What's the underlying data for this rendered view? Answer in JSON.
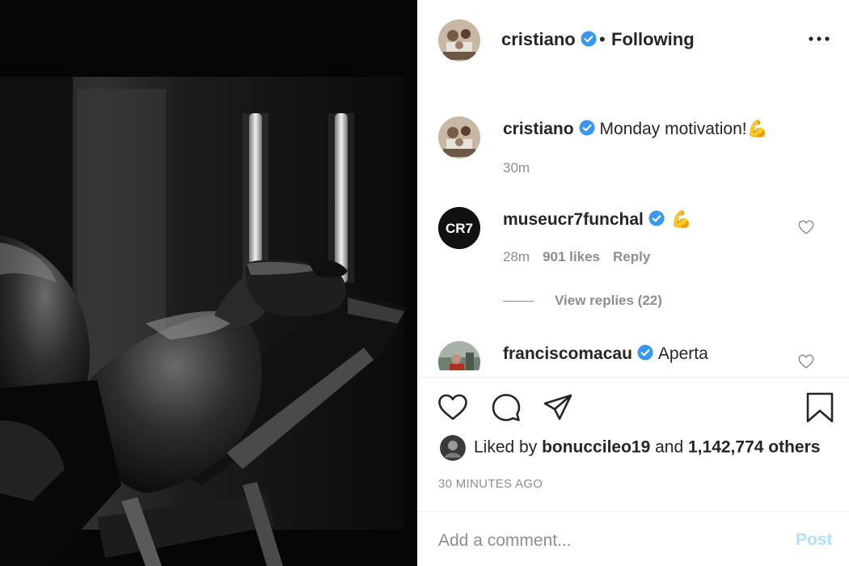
{
  "header": {
    "username": "cristiano",
    "separator": "•",
    "follow_status": "Following",
    "avatar_icon": "profile-avatar",
    "verified_icon": "verified-badge-icon",
    "more_icon": "more-options-icon"
  },
  "caption": {
    "username": "cristiano",
    "text": "Monday motivation!",
    "emoji": "💪",
    "time": "30m"
  },
  "comments": [
    {
      "username": "museucr7funchal",
      "text": "",
      "emoji": "💪",
      "time": "28m",
      "likes": "901 likes",
      "reply_label": "Reply",
      "view_replies": "View replies (22)",
      "avatar_text": "CR7"
    },
    {
      "username": "franciscomacau",
      "text": "Aperta"
    }
  ],
  "actions": {
    "like_icon": "heart-icon",
    "comment_icon": "comment-icon",
    "share_icon": "share-icon",
    "save_icon": "bookmark-icon"
  },
  "likes": {
    "prefix": "Liked by",
    "user": "bonuccileo19",
    "middle": "and",
    "count": "1,142,774 others"
  },
  "timestamp": "30 MINUTES AGO",
  "comment_box": {
    "placeholder": "Add a comment...",
    "post_label": "Post"
  },
  "colors": {
    "verified": "#3897f0",
    "muted": "#8e8e8e",
    "post_disabled": "#b2dffc",
    "text": "#262626"
  }
}
